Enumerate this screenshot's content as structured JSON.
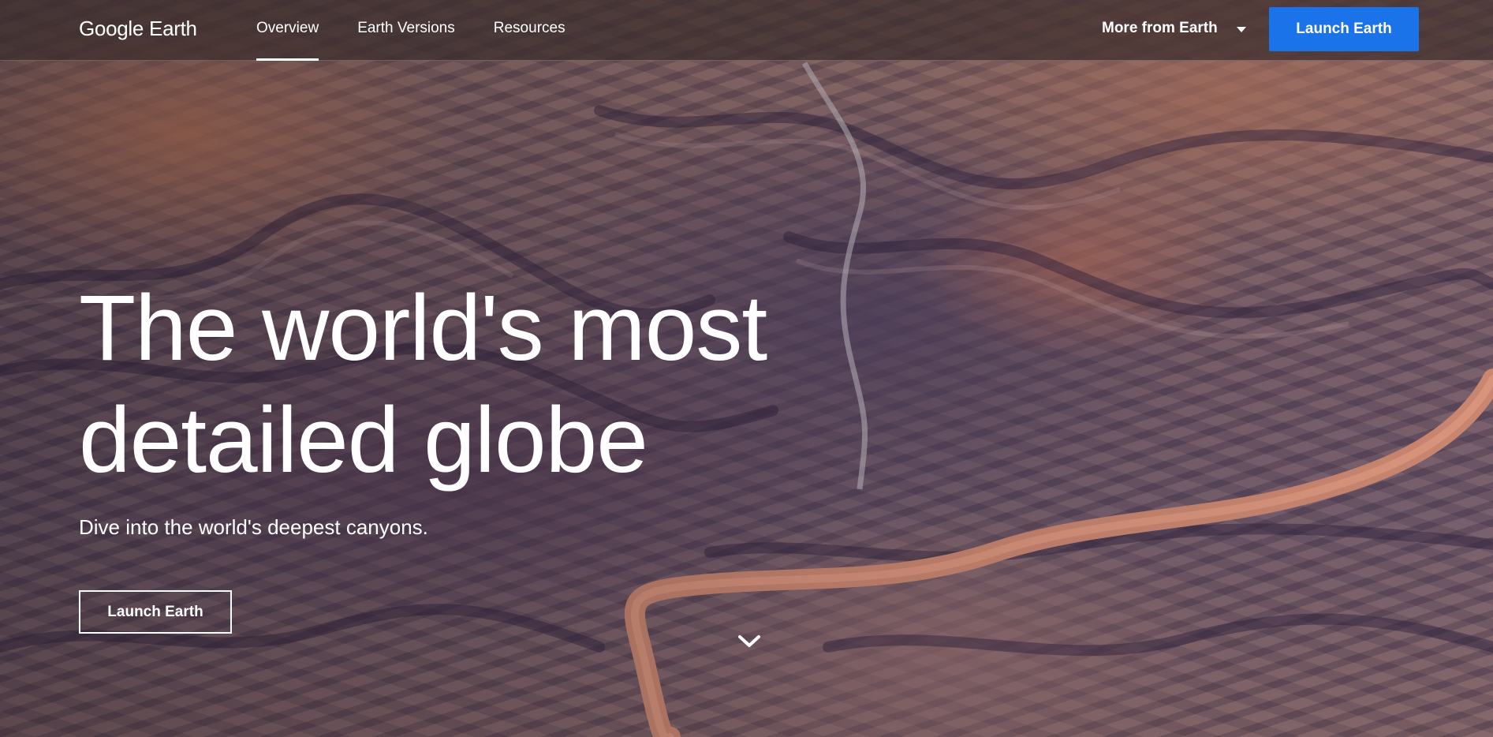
{
  "header": {
    "logo": {
      "brand": "Google",
      "product": "Earth"
    },
    "tabs": [
      {
        "label": "Overview",
        "active": true
      },
      {
        "label": "Earth Versions",
        "active": false
      },
      {
        "label": "Resources",
        "active": false
      }
    ],
    "more_menu": {
      "label": "More from Earth",
      "icon": "caret-down-icon"
    },
    "launch_button": {
      "label": "Launch Earth",
      "color": "#1a73e8"
    }
  },
  "hero": {
    "title_line1": "The world's most",
    "title_line2": "detailed globe",
    "subtitle": "Dive into the world's deepest canyons.",
    "launch_button": {
      "label": "Launch Earth"
    },
    "scroll_icon": "chevron-down-icon",
    "background": "aerial-canyon-image"
  }
}
